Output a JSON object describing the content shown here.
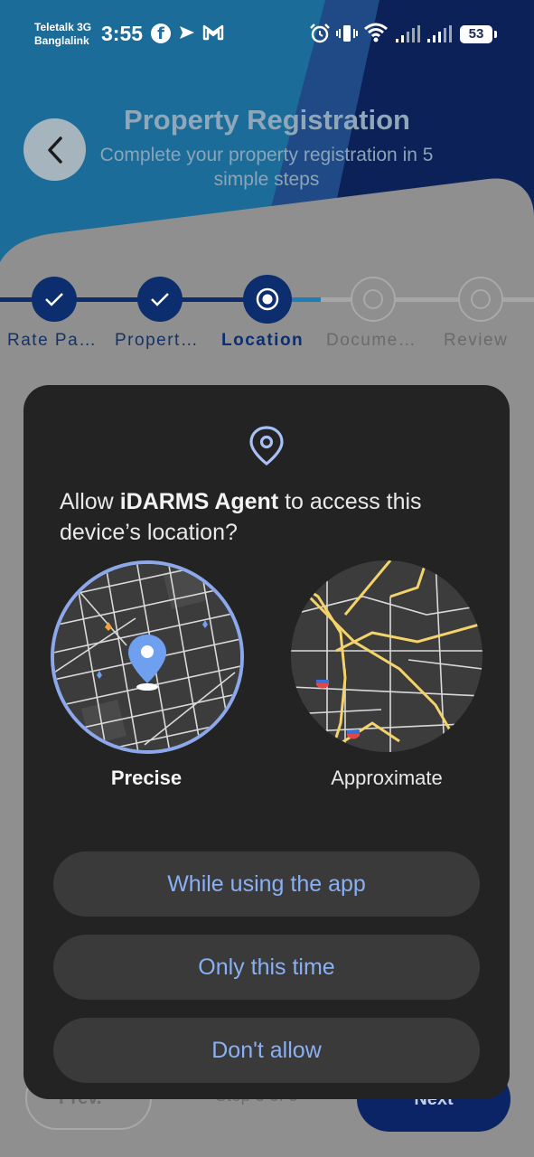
{
  "status_bar": {
    "carrier_line1": "Teletalk 3G",
    "carrier_line2": "Banglalink",
    "time": "3:55",
    "battery": "53"
  },
  "header": {
    "title": "Property Registration",
    "subtitle": "Complete your property registration in 5 simple steps"
  },
  "stepper": {
    "steps": [
      {
        "label": "Rate Pa…",
        "state": "done"
      },
      {
        "label": "Propert…",
        "state": "done"
      },
      {
        "label": "Location",
        "state": "current"
      },
      {
        "label": "Docume…",
        "state": "todo"
      },
      {
        "label": "Review",
        "state": "todo"
      }
    ]
  },
  "bottom_nav": {
    "prev_label": "Prev.",
    "step_count": "Step 3 of 5",
    "next_label": "Next"
  },
  "dialog": {
    "prefix": "Allow ",
    "app_name": "iDARMS Agent",
    "suffix": " to access this device’s location?",
    "precise_label": "Precise",
    "approximate_label": "Approximate",
    "buttons": {
      "while_using": "While using the app",
      "only_this_time": "Only this time",
      "dont_allow": "Don't allow"
    }
  },
  "colors": {
    "accent": "#8ab0f4",
    "dialog_bg": "#232323",
    "button_bg": "#3a3a3a",
    "brand_dark": "#0c2e6e",
    "header_blue": "#1f6e9b"
  }
}
